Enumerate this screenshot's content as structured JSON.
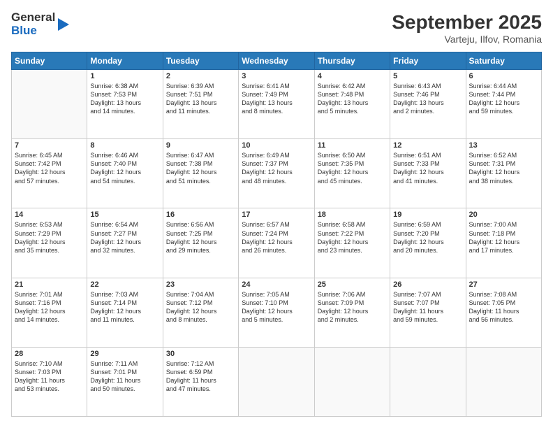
{
  "header": {
    "logo_line1": "General",
    "logo_line2": "Blue",
    "month": "September 2025",
    "location": "Varteju, Ilfov, Romania"
  },
  "weekdays": [
    "Sunday",
    "Monday",
    "Tuesday",
    "Wednesday",
    "Thursday",
    "Friday",
    "Saturday"
  ],
  "weeks": [
    [
      {
        "day": "",
        "text": ""
      },
      {
        "day": "1",
        "text": "Sunrise: 6:38 AM\nSunset: 7:53 PM\nDaylight: 13 hours\nand 14 minutes."
      },
      {
        "day": "2",
        "text": "Sunrise: 6:39 AM\nSunset: 7:51 PM\nDaylight: 13 hours\nand 11 minutes."
      },
      {
        "day": "3",
        "text": "Sunrise: 6:41 AM\nSunset: 7:49 PM\nDaylight: 13 hours\nand 8 minutes."
      },
      {
        "day": "4",
        "text": "Sunrise: 6:42 AM\nSunset: 7:48 PM\nDaylight: 13 hours\nand 5 minutes."
      },
      {
        "day": "5",
        "text": "Sunrise: 6:43 AM\nSunset: 7:46 PM\nDaylight: 13 hours\nand 2 minutes."
      },
      {
        "day": "6",
        "text": "Sunrise: 6:44 AM\nSunset: 7:44 PM\nDaylight: 12 hours\nand 59 minutes."
      }
    ],
    [
      {
        "day": "7",
        "text": "Sunrise: 6:45 AM\nSunset: 7:42 PM\nDaylight: 12 hours\nand 57 minutes."
      },
      {
        "day": "8",
        "text": "Sunrise: 6:46 AM\nSunset: 7:40 PM\nDaylight: 12 hours\nand 54 minutes."
      },
      {
        "day": "9",
        "text": "Sunrise: 6:47 AM\nSunset: 7:38 PM\nDaylight: 12 hours\nand 51 minutes."
      },
      {
        "day": "10",
        "text": "Sunrise: 6:49 AM\nSunset: 7:37 PM\nDaylight: 12 hours\nand 48 minutes."
      },
      {
        "day": "11",
        "text": "Sunrise: 6:50 AM\nSunset: 7:35 PM\nDaylight: 12 hours\nand 45 minutes."
      },
      {
        "day": "12",
        "text": "Sunrise: 6:51 AM\nSunset: 7:33 PM\nDaylight: 12 hours\nand 41 minutes."
      },
      {
        "day": "13",
        "text": "Sunrise: 6:52 AM\nSunset: 7:31 PM\nDaylight: 12 hours\nand 38 minutes."
      }
    ],
    [
      {
        "day": "14",
        "text": "Sunrise: 6:53 AM\nSunset: 7:29 PM\nDaylight: 12 hours\nand 35 minutes."
      },
      {
        "day": "15",
        "text": "Sunrise: 6:54 AM\nSunset: 7:27 PM\nDaylight: 12 hours\nand 32 minutes."
      },
      {
        "day": "16",
        "text": "Sunrise: 6:56 AM\nSunset: 7:25 PM\nDaylight: 12 hours\nand 29 minutes."
      },
      {
        "day": "17",
        "text": "Sunrise: 6:57 AM\nSunset: 7:24 PM\nDaylight: 12 hours\nand 26 minutes."
      },
      {
        "day": "18",
        "text": "Sunrise: 6:58 AM\nSunset: 7:22 PM\nDaylight: 12 hours\nand 23 minutes."
      },
      {
        "day": "19",
        "text": "Sunrise: 6:59 AM\nSunset: 7:20 PM\nDaylight: 12 hours\nand 20 minutes."
      },
      {
        "day": "20",
        "text": "Sunrise: 7:00 AM\nSunset: 7:18 PM\nDaylight: 12 hours\nand 17 minutes."
      }
    ],
    [
      {
        "day": "21",
        "text": "Sunrise: 7:01 AM\nSunset: 7:16 PM\nDaylight: 12 hours\nand 14 minutes."
      },
      {
        "day": "22",
        "text": "Sunrise: 7:03 AM\nSunset: 7:14 PM\nDaylight: 12 hours\nand 11 minutes."
      },
      {
        "day": "23",
        "text": "Sunrise: 7:04 AM\nSunset: 7:12 PM\nDaylight: 12 hours\nand 8 minutes."
      },
      {
        "day": "24",
        "text": "Sunrise: 7:05 AM\nSunset: 7:10 PM\nDaylight: 12 hours\nand 5 minutes."
      },
      {
        "day": "25",
        "text": "Sunrise: 7:06 AM\nSunset: 7:09 PM\nDaylight: 12 hours\nand 2 minutes."
      },
      {
        "day": "26",
        "text": "Sunrise: 7:07 AM\nSunset: 7:07 PM\nDaylight: 11 hours\nand 59 minutes."
      },
      {
        "day": "27",
        "text": "Sunrise: 7:08 AM\nSunset: 7:05 PM\nDaylight: 11 hours\nand 56 minutes."
      }
    ],
    [
      {
        "day": "28",
        "text": "Sunrise: 7:10 AM\nSunset: 7:03 PM\nDaylight: 11 hours\nand 53 minutes."
      },
      {
        "day": "29",
        "text": "Sunrise: 7:11 AM\nSunset: 7:01 PM\nDaylight: 11 hours\nand 50 minutes."
      },
      {
        "day": "30",
        "text": "Sunrise: 7:12 AM\nSunset: 6:59 PM\nDaylight: 11 hours\nand 47 minutes."
      },
      {
        "day": "",
        "text": ""
      },
      {
        "day": "",
        "text": ""
      },
      {
        "day": "",
        "text": ""
      },
      {
        "day": "",
        "text": ""
      }
    ]
  ]
}
